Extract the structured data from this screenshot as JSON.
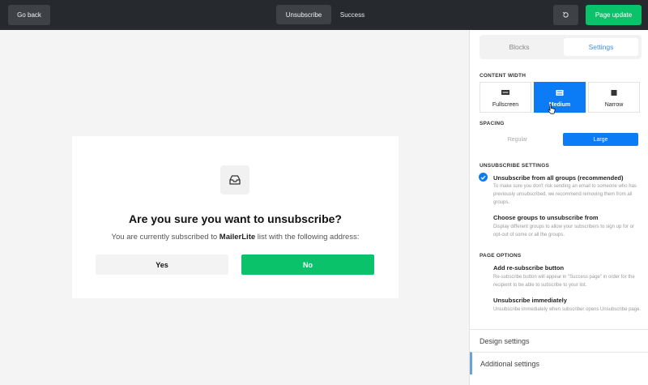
{
  "topbar": {
    "go_back": "Go back",
    "tabs": [
      {
        "label": "Unsubscribe"
      },
      {
        "label": "Success"
      }
    ],
    "page_update": "Page update"
  },
  "card": {
    "title": "Are you sure you want to unsubscribe?",
    "text_before": "You are currently subscribed to",
    "brand": "MailerLite",
    "text_after": "list with the following address:",
    "yes_label": "Yes",
    "no_label": "No"
  },
  "panel": {
    "tabs": [
      {
        "label": "Blocks"
      },
      {
        "label": "Settings"
      }
    ],
    "content_width": {
      "heading": "CONTENT WIDTH",
      "options": [
        {
          "label": "Fullscreen",
          "icon": "fullscreen-width-icon"
        },
        {
          "label": "Medium",
          "icon": "medium-width-icon",
          "selected": true
        },
        {
          "label": "Narrow",
          "icon": "narrow-width-icon"
        }
      ]
    },
    "spacing": {
      "heading": "SPACING",
      "options": [
        "Regular",
        "Large"
      ],
      "selected": "Large"
    },
    "unsubscribe_settings": {
      "heading": "UNSUBSCRIBE SETTINGS",
      "options": [
        {
          "title": "Unsubscribe from all groups (recommended)",
          "desc": "To make sure you don't risk sending an email to someone who has previously unsubscribed, we recommend removing them from all groups.",
          "checked": true
        },
        {
          "title": "Choose groups to unsubscribe from",
          "desc": "Display different groups to allow your subscribers to sign up for or opt-out of some or all the groups.",
          "checked": false
        }
      ]
    },
    "page_options": {
      "heading": "PAGE OPTIONS",
      "options": [
        {
          "title": "Add re-subscribe button",
          "desc": "Re-subscribe button will appear in \"Success page\" in order for the recipient to be able to subscribe to your list."
        },
        {
          "title": "Unsubscribe immediately",
          "desc": "Unsubscribe immediately when subscriber opens Unsubscribe page."
        }
      ]
    },
    "design_settings": "Design settings",
    "additional_settings": "Additional settings"
  },
  "colors": {
    "topbar_bg": "#262a2e",
    "accent_green": "#0ac26a",
    "accent_blue": "#0b7cf5"
  }
}
